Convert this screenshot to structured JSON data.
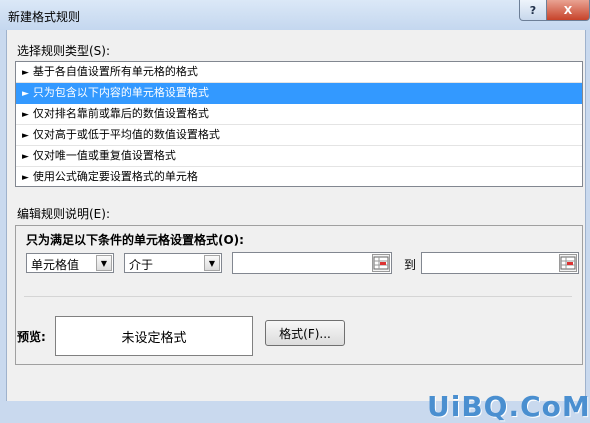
{
  "window": {
    "title": "新建格式规则",
    "help_label": "?",
    "close_label": "X"
  },
  "rule_type": {
    "label": "选择规则类型(S):",
    "items": [
      {
        "label": "基于各自值设置所有单元格的格式",
        "selected": false
      },
      {
        "label": "只为包含以下内容的单元格设置格式",
        "selected": true
      },
      {
        "label": "仅对排名靠前或靠后的数值设置格式",
        "selected": false
      },
      {
        "label": "仅对高于或低于平均值的数值设置格式",
        "selected": false
      },
      {
        "label": "仅对唯一值或重复值设置格式",
        "selected": false
      },
      {
        "label": "使用公式确定要设置格式的单元格",
        "selected": false
      }
    ]
  },
  "rule_desc": {
    "label": "编辑规则说明(E):",
    "heading": "只为满足以下条件的单元格设置格式(O):",
    "field_select": "单元格值",
    "operator_select": "介于",
    "value1": "",
    "to_label": "到",
    "value2": ""
  },
  "preview": {
    "label": "预览:",
    "text": "未设定格式",
    "format_button": "格式(F)..."
  },
  "watermark": "UiBQ.CoM",
  "colors": {
    "selection": "#3399ff",
    "titlebar": "#c4d7ef",
    "dialog_bg": "#f0f0f0"
  }
}
